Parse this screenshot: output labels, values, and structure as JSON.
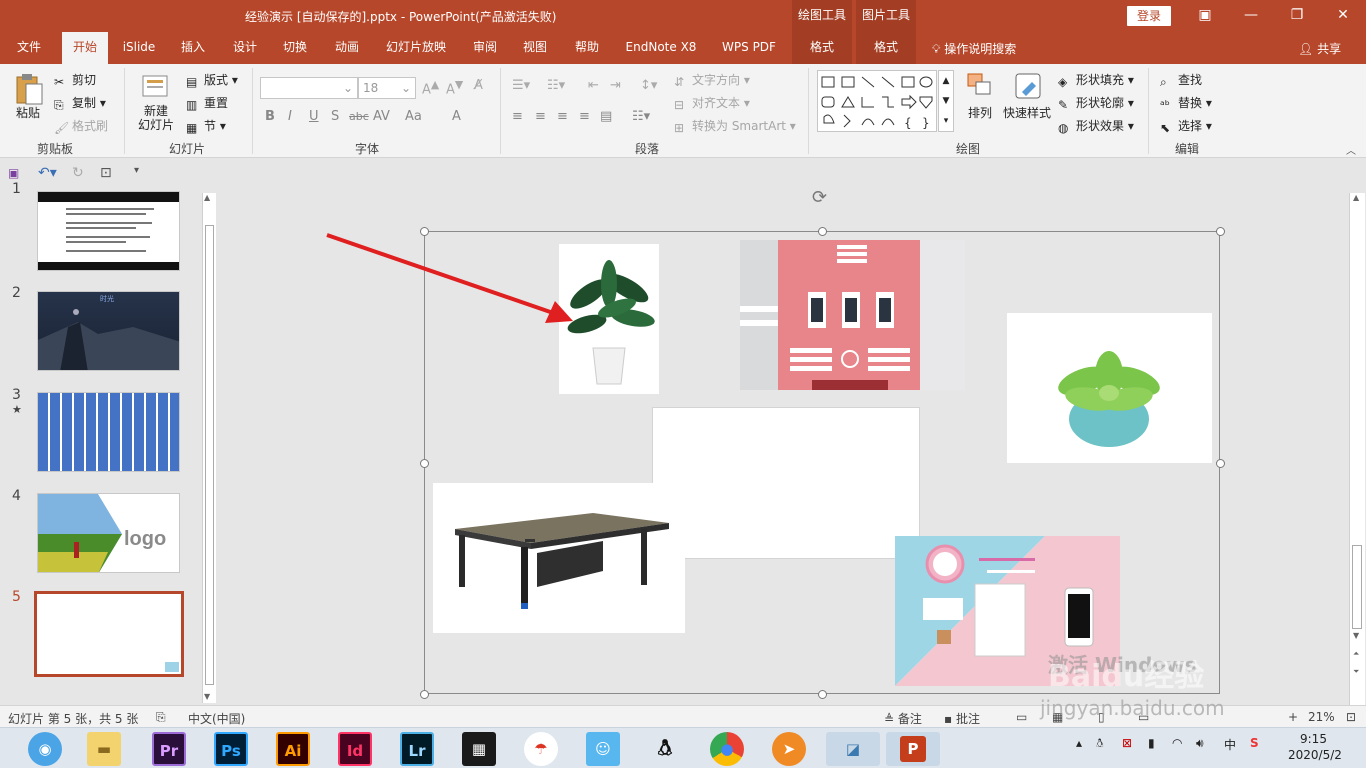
{
  "window": {
    "title": "经验演示 [自动保存的].pptx  -  PowerPoint(产品激活失败)",
    "context_tools": [
      "绘图工具",
      "图片工具"
    ],
    "login_label": "登录",
    "controls": [
      "▣",
      "—",
      "❐",
      "✕"
    ]
  },
  "tabs": [
    "文件",
    "开始",
    "iSlide",
    "插入",
    "设计",
    "切换",
    "动画",
    "幻灯片放映",
    "审阅",
    "视图",
    "帮助",
    "EndNote X8",
    "WPS PDF",
    "格式",
    "格式"
  ],
  "active_tab": "开始",
  "search_label": "操作说明搜索",
  "share_label": "共享",
  "ribbon": {
    "clipboard": {
      "paste": "粘贴",
      "cut": "剪切",
      "copy": "复制",
      "format_painter": "格式刷",
      "group": "剪贴板"
    },
    "slides": {
      "new_slide": "新建\n幻灯片",
      "layout": "版式",
      "reset": "重置",
      "section": "节",
      "group": "幻灯片"
    },
    "font": {
      "font_size": "18",
      "group": "字体",
      "buttons": [
        "B",
        "I",
        "U",
        "S",
        "abc",
        "AV",
        "Aa",
        "A"
      ]
    },
    "paragraph": {
      "text_direction": "文字方向",
      "align_text": "对齐文本",
      "smartart": "转换为 SmartArt",
      "group": "段落"
    },
    "drawing": {
      "arrange": "排列",
      "quick_styles": "快速样式",
      "fill": "形状填充",
      "outline": "形状轮廓",
      "effects": "形状效果",
      "group": "绘图"
    },
    "editing": {
      "find": "查找",
      "replace": "替换",
      "select": "选择",
      "group": "编辑"
    }
  },
  "thumbnails": [
    {
      "num": "1",
      "star": false
    },
    {
      "num": "2",
      "star": false,
      "caption": "时光"
    },
    {
      "num": "3",
      "star": true
    },
    {
      "num": "4",
      "star": false,
      "logo": "logo"
    },
    {
      "num": "5",
      "star": false,
      "active": true
    }
  ],
  "statusbar": {
    "slide_info": "幻灯片 第 5 张，共 5 张",
    "language": "中文(中国)",
    "notes": "备注",
    "comments": "批注",
    "zoom": "21%"
  },
  "taskbar": {
    "apps": [
      "Pr",
      "Ps",
      "Ai",
      "Id",
      "Lr"
    ],
    "time": "9:15",
    "date": "2020/5/2",
    "ime": "中"
  },
  "watermark": {
    "line1": "激活 Windows",
    "brand": "Baidu经验",
    "url": "jingyan.baidu.com"
  },
  "colors": {
    "accent": "#b7472a",
    "arrow": "#e02020"
  }
}
